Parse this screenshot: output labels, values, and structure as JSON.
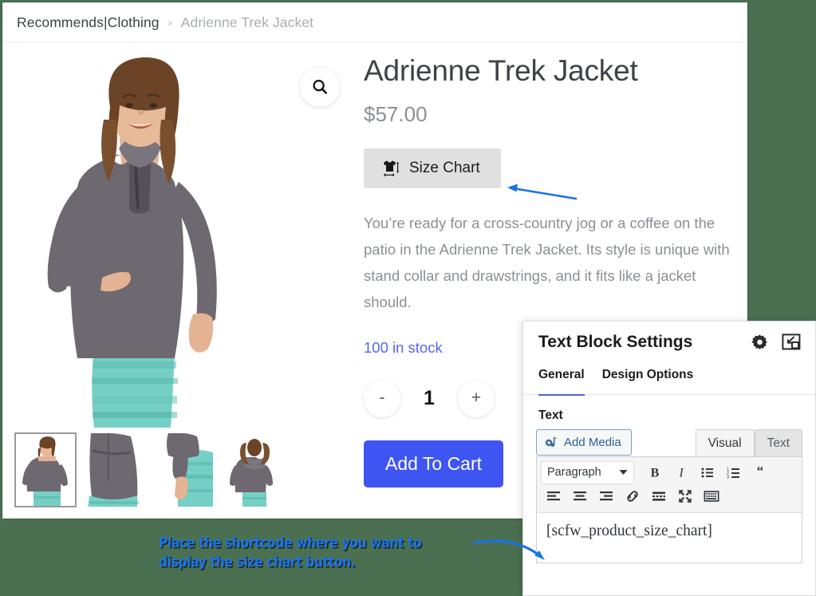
{
  "theme": {
    "page_background": "#4a7051",
    "accent_blue": "#3f55f2",
    "link_blue": "#5566f0",
    "annotation_blue": "#1a73e8",
    "tab_underline": "#4f63d2"
  },
  "breadcrumb": {
    "parent": "Recommends|Clothing",
    "separator": "›",
    "current": "Adrienne Trek Jacket"
  },
  "gallery": {
    "zoom_icon": "search-icon",
    "thumbnails": [
      {
        "alt": "Model front view",
        "selected": true
      },
      {
        "alt": "Jacket back detail",
        "selected": false
      },
      {
        "alt": "Jacket sleeve and hip detail",
        "selected": false
      },
      {
        "alt": "Model back view",
        "selected": false
      }
    ]
  },
  "product": {
    "title": "Adrienne Trek Jacket",
    "price": "$57.00",
    "size_chart_label": "Size Chart",
    "size_chart_icon": "tshirt-measure-icon",
    "description": "You’re ready for a cross-country jog or a coffee on the patio in the Adrienne Trek Jacket. Its style is unique with stand collar and drawstrings, and it fits like a jacket should.",
    "stock_status": "100 in stock",
    "quantity": {
      "decrease_label": "-",
      "value": "1",
      "increase_label": "+"
    },
    "add_to_cart_label": "Add To Cart"
  },
  "settings_panel": {
    "title": "Text Block Settings",
    "header_icons": [
      {
        "name": "gear-icon"
      },
      {
        "name": "minimize-window-icon"
      }
    ],
    "tabs": [
      {
        "label": "General",
        "active": true
      },
      {
        "label": "Design Options",
        "active": false
      }
    ],
    "field_label": "Text",
    "add_media_label": "Add Media",
    "add_media_icon": "media-icon",
    "editor_tabs": [
      {
        "label": "Visual",
        "active": true
      },
      {
        "label": "Text",
        "active": false
      }
    ],
    "toolbar": {
      "format_select_value": "Paragraph",
      "row1": [
        {
          "name": "bold-icon",
          "label": "B"
        },
        {
          "name": "italic-icon",
          "label": "I"
        },
        {
          "name": "bulleted-list-icon",
          "label": ""
        },
        {
          "name": "numbered-list-icon",
          "label": ""
        },
        {
          "name": "blockquote-icon",
          "label": "“"
        }
      ],
      "row2": [
        {
          "name": "align-left-icon"
        },
        {
          "name": "align-center-icon"
        },
        {
          "name": "align-right-icon"
        },
        {
          "name": "insert-link-icon"
        },
        {
          "name": "read-more-icon"
        },
        {
          "name": "fullscreen-icon"
        },
        {
          "name": "toolbar-toggle-icon"
        }
      ]
    },
    "editor_content": "[scfw_product_size_chart]"
  },
  "annotation": {
    "line1": "Place the shortcode where you want to",
    "line2": "display the size chart button."
  }
}
